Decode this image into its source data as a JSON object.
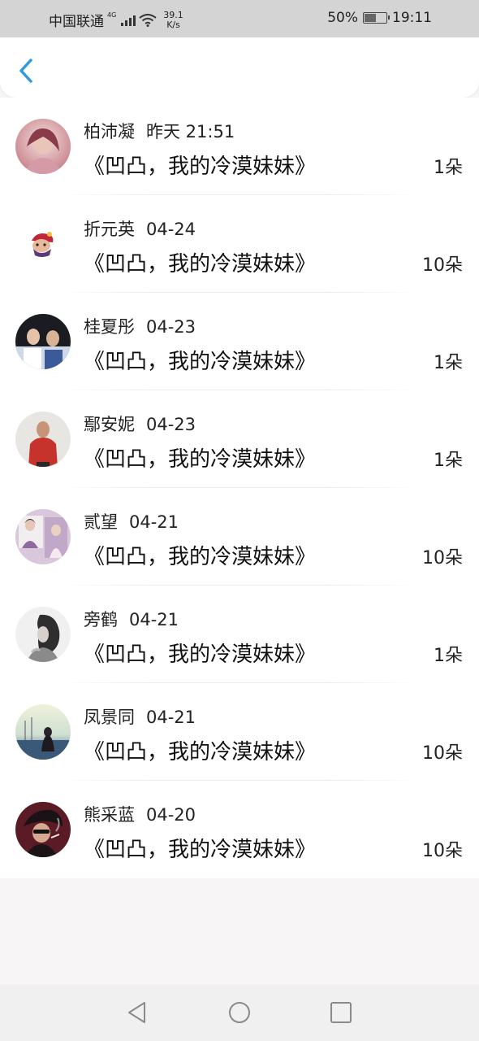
{
  "status_bar": {
    "carrier": "中国联通",
    "network_tag": "4G",
    "speed_value": "39.1",
    "speed_unit": "K/s",
    "battery": "50%",
    "battery_level": 0.5,
    "time": "19:11"
  },
  "colors": {
    "accent": "#2f9ae0",
    "status_bar_bg": "#d4d4d4"
  },
  "items": [
    {
      "name": "柏沛凝",
      "date": "昨天 21:51",
      "title": "《凹凸，我的冷漠妹妹》",
      "count": "1朵"
    },
    {
      "name": "折元英",
      "date": "04-24",
      "title": "《凹凸，我的冷漠妹妹》",
      "count": "10朵"
    },
    {
      "name": "桂夏彤",
      "date": "04-23",
      "title": "《凹凸，我的冷漠妹妹》",
      "count": "1朵"
    },
    {
      "name": "鄢安妮",
      "date": "04-23",
      "title": "《凹凸，我的冷漠妹妹》",
      "count": "1朵"
    },
    {
      "name": "贰望",
      "date": "04-21",
      "title": "《凹凸，我的冷漠妹妹》",
      "count": "10朵"
    },
    {
      "name": "旁鹤",
      "date": "04-21",
      "title": "《凹凸，我的冷漠妹妹》",
      "count": "1朵"
    },
    {
      "name": "凤景同",
      "date": "04-21",
      "title": "《凹凸，我的冷漠妹妹》",
      "count": "10朵"
    },
    {
      "name": "熊采蓝",
      "date": "04-20",
      "title": "《凹凸，我的冷漠妹妹》",
      "count": "10朵"
    }
  ]
}
